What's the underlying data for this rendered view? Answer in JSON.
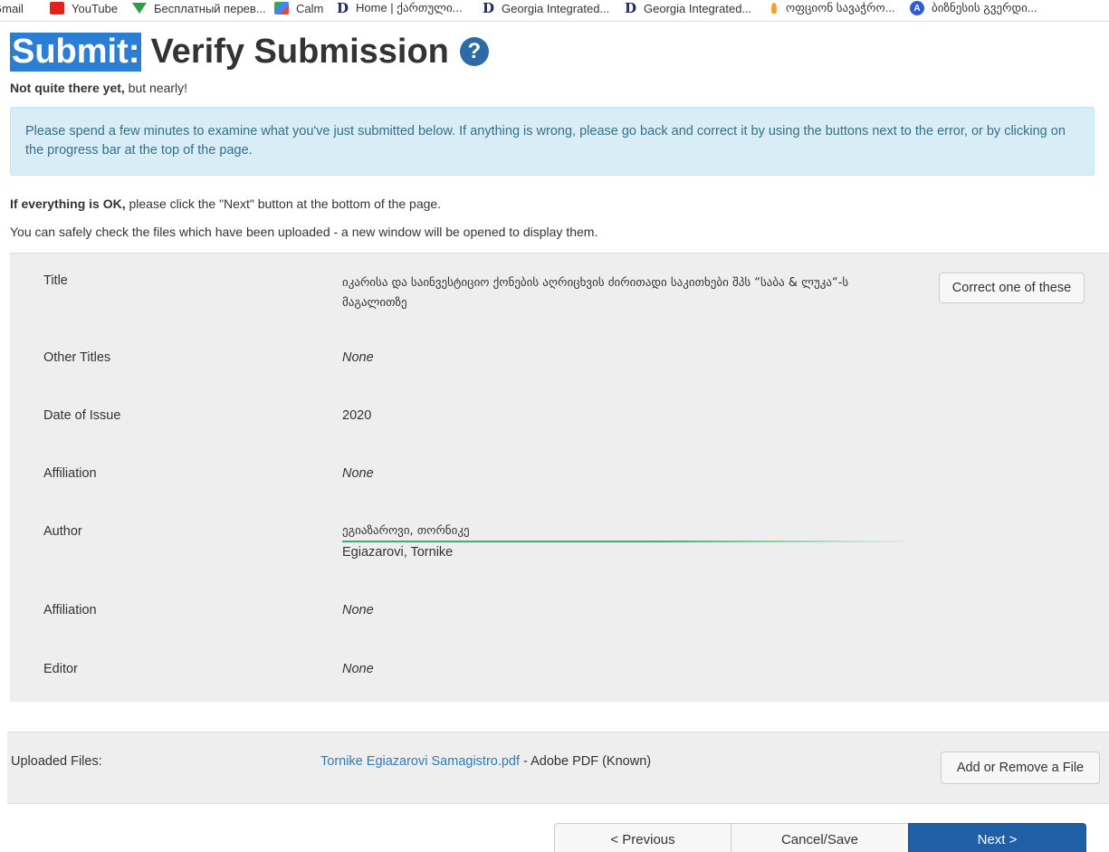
{
  "bookmarks": [
    {
      "label": "Gmail",
      "icon": "mail-icon"
    },
    {
      "label": "YouTube",
      "icon": "youtube-icon"
    },
    {
      "label": "Бесплатный перев...",
      "icon": "translate-icon"
    },
    {
      "label": "Calm",
      "icon": "calm-icon"
    },
    {
      "label": "Home | ქართული...",
      "icon": "d-icon"
    },
    {
      "label": "Georgia Integrated...",
      "icon": "d-icon"
    },
    {
      "label": "Georgia Integrated...",
      "icon": "d-icon"
    },
    {
      "label": "ოფციონ სავაჭრო...",
      "icon": "flame-icon"
    },
    {
      "label": "ბიზნესის გვერდი...",
      "icon": "a-icon"
    }
  ],
  "page": {
    "title_highlight": "Submit:",
    "title_rest": "Verify Submission",
    "help_glyph": "?",
    "status_bold": "Not quite there yet,",
    "status_rest": " but nearly!",
    "info_text": "Please spend a few minutes to examine what you've just submitted below. If anything is wrong, please go back and correct it by using the buttons next to the error, or by clicking on the progress bar at the top of the page.",
    "ok_bold": "If everything is OK,",
    "ok_rest": " please click the \"Next\" button at the bottom of the page.",
    "files_note": "You can safely check the files which have been uploaded - a new window will be opened to display them."
  },
  "metadata": {
    "title_label": "Title",
    "title_value": "იკარისა და საინვესტიციო ქონების აღრიცხვის ძირითადი საკითხები შპს “საბა & ლუკა“-ს მაგალითზე",
    "other_titles_label": "Other Titles",
    "other_titles_value": "None",
    "date_label": "Date of Issue",
    "date_value": "2020",
    "affiliation1_label": "Affiliation",
    "affiliation1_value": "None",
    "author_label": "Author",
    "author_value_geo": "ეგიაზაროვი, თორნიკე",
    "author_value_lat": "Egiazarovi, Tornike",
    "affiliation2_label": "Affiliation",
    "affiliation2_value": "None",
    "editor_label": "Editor",
    "editor_value": "None",
    "correct_button": "Correct one of these"
  },
  "files": {
    "label": "Uploaded Files:",
    "file_name": "Tornike Egiazarovi Samagistro.pdf",
    "file_type": " - Adobe PDF (Known)",
    "add_remove_button": "Add or Remove a File"
  },
  "navigation": {
    "previous": "< Previous",
    "cancel": "Cancel/Save",
    "next": "Next >"
  },
  "colors": {
    "info_bg": "#d9edf7",
    "info_text": "#31708f",
    "primary": "#1f5fa5",
    "link": "#337ab7",
    "selection": "#2a7fd4"
  }
}
